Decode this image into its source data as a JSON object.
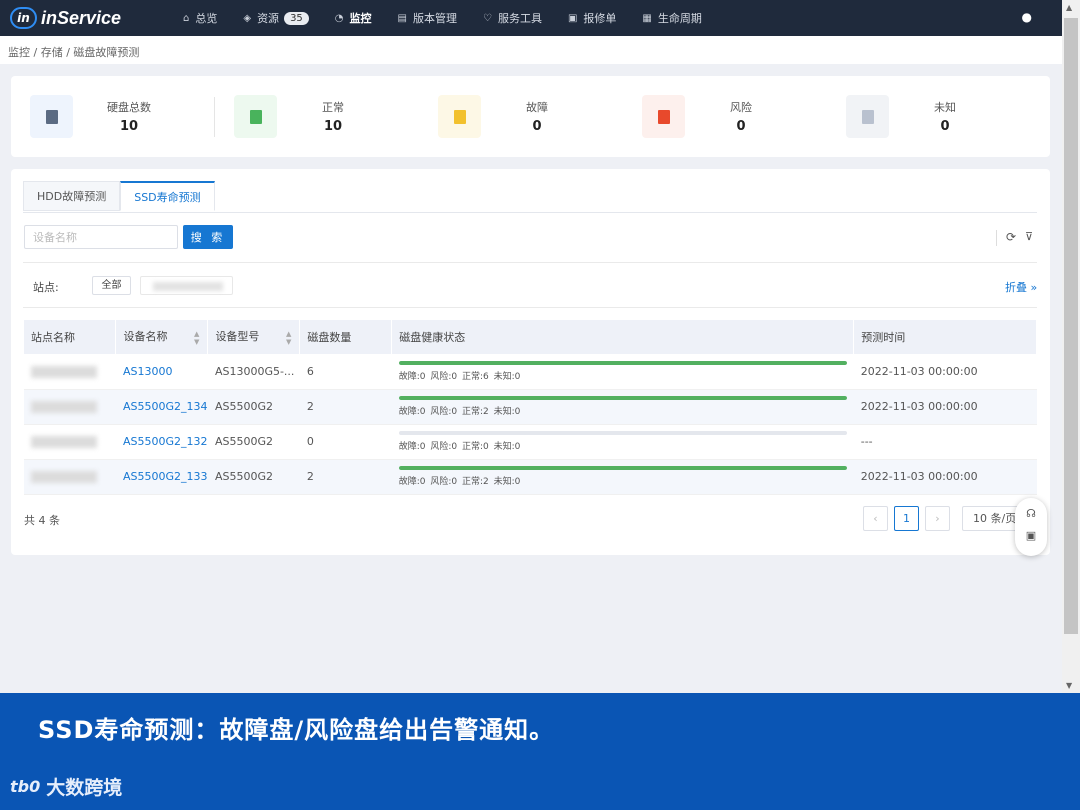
{
  "app": {
    "logo_mark": "in",
    "logo_text": "inService"
  },
  "nav": [
    {
      "icon": "⌂",
      "label": "总览"
    },
    {
      "icon": "◈",
      "label": "资源",
      "badge": "35"
    },
    {
      "icon": "◔",
      "label": "监控"
    },
    {
      "icon": "▤",
      "label": "版本管理"
    },
    {
      "icon": "♡",
      "label": "服务工具"
    },
    {
      "icon": "▣",
      "label": "报修单"
    },
    {
      "icon": "▦",
      "label": "生命周期"
    }
  ],
  "user_icon": "●",
  "breadcrumb": "监控 / 存储 / 磁盘故障预测",
  "stats": [
    {
      "label": "硬盘总数",
      "value": "10",
      "color": "#5b6b83",
      "bg": "#eef4fd"
    },
    {
      "label": "正常",
      "value": "10",
      "color": "#49b35c",
      "bg": "#edf9ef"
    },
    {
      "label": "故障",
      "value": "0",
      "color": "#f2c12e",
      "bg": "#fdf8e6"
    },
    {
      "label": "风险",
      "value": "0",
      "color": "#e8492c",
      "bg": "#fdf0ed"
    },
    {
      "label": "未知",
      "value": "0",
      "color": "#b9c1cf",
      "bg": "#f1f3f6"
    }
  ],
  "tabs": [
    {
      "label": "HDD故障预测"
    },
    {
      "label": "SSD寿命预测"
    }
  ],
  "search": {
    "placeholder": "设备名称",
    "button": "搜 索"
  },
  "tools": {
    "refresh_icon": "⟳",
    "filter_icon": "⊽"
  },
  "filter": {
    "site_label": "站点:",
    "all_chip": "全部",
    "collapse": "折叠 »"
  },
  "table": {
    "columns": [
      "站点名称",
      "设备名称",
      "设备型号",
      "磁盘数量",
      "磁盘健康状态",
      "预测时间"
    ],
    "rows": [
      {
        "device": "AS13000",
        "model": "AS13000G5-...",
        "disks": "6",
        "health": 1.0,
        "status": "故障:0  风险:0  正常:6  未知:0",
        "time": "2022-11-03 00:00:00"
      },
      {
        "device": "AS5500G2_134",
        "model": "AS5500G2",
        "disks": "2",
        "health": 1.0,
        "status": "故障:0  风险:0  正常:2  未知:0",
        "time": "2022-11-03 00:00:00"
      },
      {
        "device": "AS5500G2_132",
        "model": "AS5500G2",
        "disks": "0",
        "health": 0,
        "status": "故障:0  风险:0  正常:0  未知:0",
        "time": "---"
      },
      {
        "device": "AS5500G2_133",
        "model": "AS5500G2",
        "disks": "2",
        "health": 1.0,
        "status": "故障:0  风险:0  正常:2  未知:0",
        "time": "2022-11-03 00:00:00"
      }
    ]
  },
  "pagination": {
    "total": "共 4 条",
    "prev": "‹",
    "page": "1",
    "next": "›",
    "size": "10 条/页"
  },
  "float_tools": {
    "support_icon": "☊",
    "save_icon": "▣"
  },
  "banner": {
    "text": "SSD寿命预测：故障盘/风险盘给出告警通知。",
    "brand_mark": "tb0",
    "brand": "大数跨境"
  }
}
